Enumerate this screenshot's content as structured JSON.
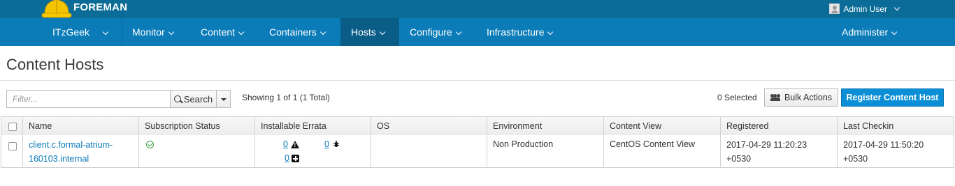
{
  "app": {
    "brand": "FOREMAN"
  },
  "user": {
    "name": "Admin User"
  },
  "nav": {
    "org": "ITzGeek",
    "items": [
      {
        "label": "Monitor"
      },
      {
        "label": "Content"
      },
      {
        "label": "Containers"
      },
      {
        "label": "Hosts"
      },
      {
        "label": "Configure"
      },
      {
        "label": "Infrastructure"
      }
    ],
    "admin": "Administer",
    "active": "Hosts"
  },
  "page": {
    "title": "Content Hosts"
  },
  "search": {
    "placeholder": "Filter...",
    "button_label": "Search",
    "showing": "Showing 1 of 1 (1 Total)"
  },
  "actions": {
    "selected": "0 Selected",
    "bulk_label": "Bulk Actions",
    "register_label": "Register Content Host"
  },
  "table": {
    "columns": [
      "Name",
      "Subscription Status",
      "Installable Errata",
      "OS",
      "Environment",
      "Content View",
      "Registered",
      "Last Checkin"
    ],
    "rows": [
      {
        "name_line1": "client.c.formal-atrium-",
        "name_line2": "160103.internal",
        "subscription_status": "valid",
        "errata": {
          "security": "0",
          "bugfix": "0",
          "enhancement": "0"
        },
        "os": "",
        "environment": "Non Production",
        "content_view": "CentOS Content View",
        "registered_line1": "2017-04-29 11:20:23",
        "registered_line2": "+0530",
        "checkin_line1": "2017-04-29 11:50:20",
        "checkin_line2": "+0530"
      }
    ]
  },
  "colors": {
    "topbar": "#0b6c97",
    "navbar": "#0b7cb8",
    "nav_active": "#0a5d87",
    "primary_button": "#0a8fd6",
    "link": "#0a79b8",
    "status_ok": "#3a9a3a"
  },
  "icons": [
    "hardhat-logo-icon",
    "user-avatar-icon",
    "search-icon",
    "users-icon",
    "check-circle-icon",
    "security-warning-icon",
    "bug-icon",
    "enhancement-plus-icon"
  ]
}
